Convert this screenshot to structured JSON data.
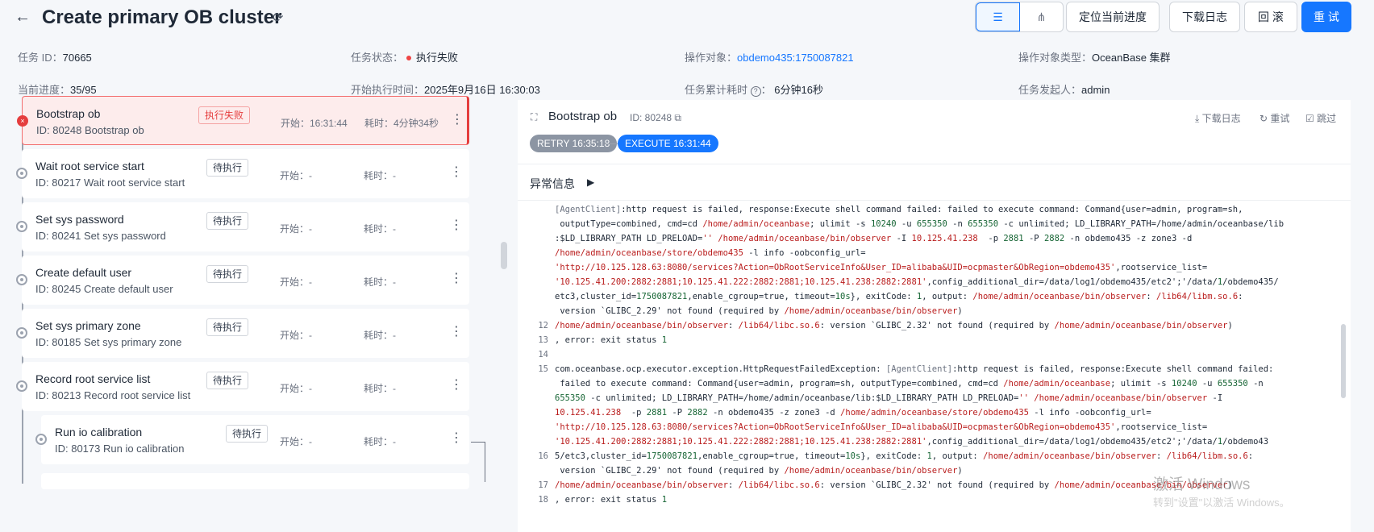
{
  "header": {
    "back_icon": "arrow-left-icon",
    "title": "Create primary OB cluster",
    "refresh_icon": "refresh-icon",
    "view_list_icon": "list-view-icon",
    "view_tree_icon": "tree-view-icon",
    "locate_label": "定位当前进度",
    "download_label": "下载日志",
    "rollback_label": "回 滚",
    "retry_label": "重 试"
  },
  "info": {
    "task_id_label": "任务 ID：",
    "task_id": "70665",
    "status_label": "任务状态：",
    "status": "执行失败",
    "status_color": "#ef4444",
    "target_label": "操作对象：",
    "target": "obdemo435:1750087821",
    "target_type_label": "操作对象类型：",
    "target_type": "OceanBase 集群",
    "progress_label": "当前进度：",
    "progress": "35/95",
    "start_time_label": "开始执行时间：",
    "start_time": "2025年9月16日 16:30:03",
    "elapsed_label": "任务累计耗时",
    "elapsed": "6分钟16秒",
    "initiator_label": "任务发起人：",
    "initiator": "admin"
  },
  "steps": [
    {
      "name": "Bootstrap ob",
      "id": "ID: 80248  Bootstrap ob",
      "tag": "执行失败",
      "start": "开始：16:31:44",
      "cost": "耗时：4分钟34秒"
    },
    {
      "name": "Wait root service start",
      "id": "ID: 80217  Wait root service start",
      "tag": "待执行",
      "start": "开始：-",
      "cost": "耗时：-"
    },
    {
      "name": "Set sys password",
      "id": "ID: 80241  Set sys password",
      "tag": "待执行",
      "start": "开始：-",
      "cost": "耗时：-"
    },
    {
      "name": "Create default user",
      "id": "ID: 80245  Create default user",
      "tag": "待执行",
      "start": "开始：-",
      "cost": "耗时：-"
    },
    {
      "name": "Set sys primary zone",
      "id": "ID: 80185  Set sys primary zone",
      "tag": "待执行",
      "start": "开始：-",
      "cost": "耗时：-"
    },
    {
      "name": "Record root service list",
      "id": "ID: 80213  Record root service list",
      "tag": "待执行",
      "start": "开始：-",
      "cost": "耗时：-"
    },
    {
      "name": "Run io calibration",
      "id": "ID: 80173  Run io calibration",
      "tag": "待执行",
      "start": "开始：-",
      "cost": "耗时：-"
    }
  ],
  "detail": {
    "title": "Bootstrap ob",
    "id": "ID: 80248",
    "download": "下载日志",
    "retry": "重试",
    "skip": "跳过",
    "chip_retry": "RETRY 16:35:18",
    "chip_execute": "EXECUTE 16:31:44",
    "exception_label": "异常信息",
    "log_line_numbers": [
      "12",
      "13",
      "14",
      "15",
      "16",
      "17",
      "18"
    ]
  },
  "watermark": {
    "title": "激活 Windows",
    "subtitle": "转到\"设置\"以激活 Windows。"
  }
}
